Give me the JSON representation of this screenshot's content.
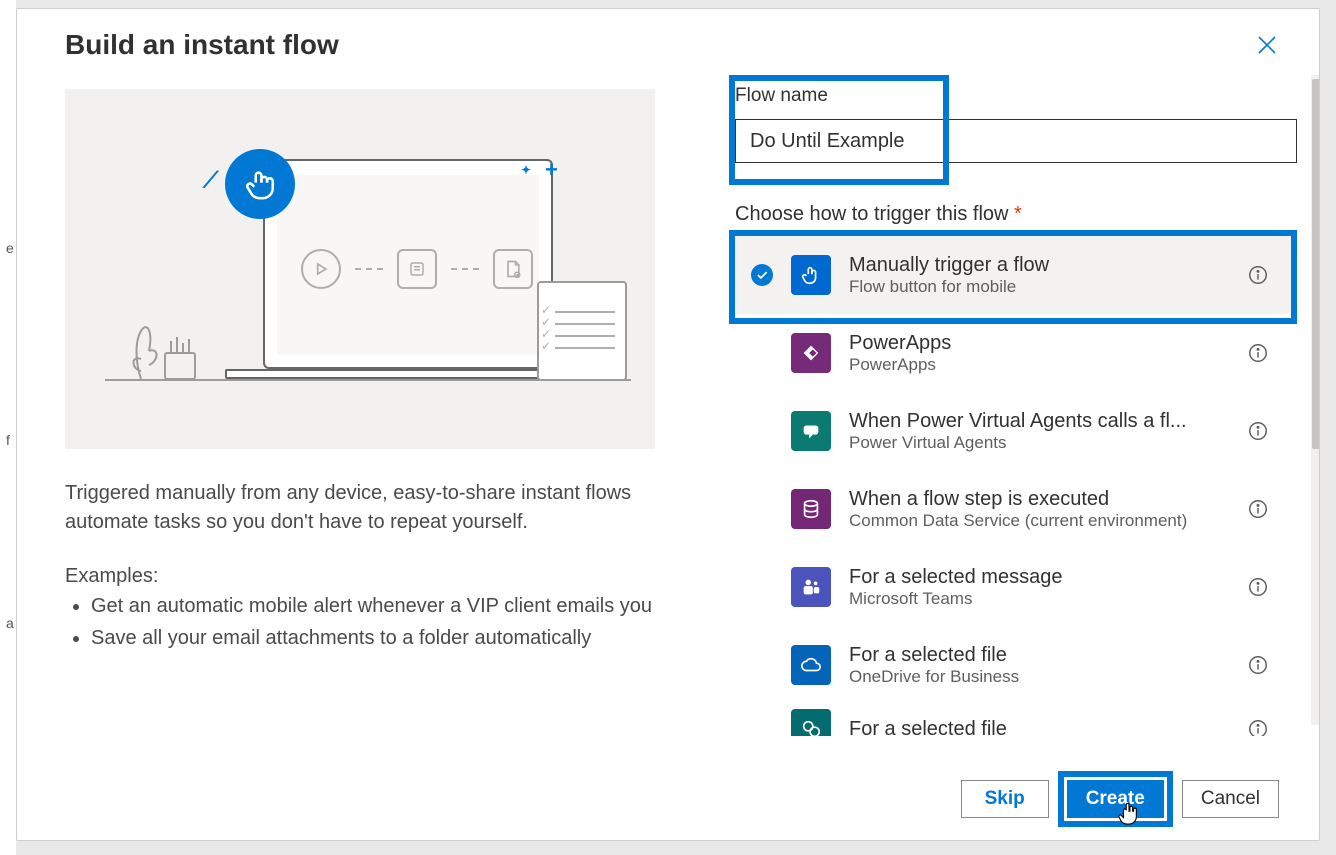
{
  "modal": {
    "title": "Build an instant flow",
    "description": "Triggered manually from any device, easy-to-share instant flows automate tasks so you don't have to repeat yourself.",
    "examples_label": "Examples:",
    "examples": [
      "Get an automatic mobile alert whenever a VIP client emails you",
      "Save all your email attachments to a folder automatically"
    ]
  },
  "form": {
    "flow_name_label": "Flow name",
    "flow_name_value": "Do Until Example",
    "trigger_label": "Choose how to trigger this flow",
    "selected_index": 0,
    "triggers": [
      {
        "title": "Manually trigger a flow",
        "subtitle": "Flow button for mobile",
        "icon": "finger"
      },
      {
        "title": "PowerApps",
        "subtitle": "PowerApps",
        "icon": "powerapps"
      },
      {
        "title": "When Power Virtual Agents calls a fl...",
        "subtitle": "Power Virtual Agents",
        "icon": "pva"
      },
      {
        "title": "When a flow step is executed",
        "subtitle": "Common Data Service (current environment)",
        "icon": "cds"
      },
      {
        "title": "For a selected message",
        "subtitle": "Microsoft Teams",
        "icon": "teams"
      },
      {
        "title": "For a selected file",
        "subtitle": "OneDrive for Business",
        "icon": "onedrive"
      },
      {
        "title": "For a selected file",
        "subtitle": "",
        "icon": "sharepoint"
      }
    ]
  },
  "footer": {
    "skip": "Skip",
    "create": "Create",
    "cancel": "Cancel"
  }
}
